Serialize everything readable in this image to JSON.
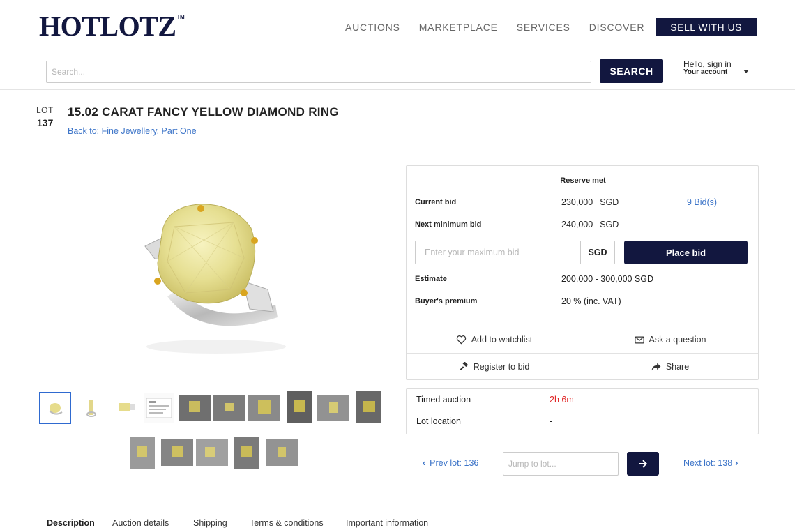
{
  "brand": {
    "logo_text": "HOTLOTZ",
    "logo_mark": "TM"
  },
  "nav": {
    "items": [
      {
        "label": "AUCTIONS"
      },
      {
        "label": "MARKETPLACE"
      },
      {
        "label": "SERVICES"
      },
      {
        "label": "DISCOVER"
      }
    ],
    "sell_label": "SELL WITH US"
  },
  "search": {
    "placeholder": "Search...",
    "button_label": "SEARCH"
  },
  "account": {
    "greeting": "Hello, sign in",
    "label": "Your account"
  },
  "lot": {
    "lot_label": "LOT",
    "number": "137",
    "title": "15.02 CARAT FANCY YELLOW DIAMOND RING",
    "back_link": "Back to: Fine Jewellery, Part One"
  },
  "bidding": {
    "reserve_status": "Reserve met",
    "current_bid_label": "Current bid",
    "current_bid_value": "230,000",
    "currency": "SGD",
    "bids_count_label": "9 Bid(s)",
    "next_min_label": "Next minimum bid",
    "next_min_value": "240,000",
    "max_bid_placeholder": "Enter your maximum bid",
    "currency_addon": "SGD",
    "place_bid_label": "Place bid",
    "estimate_label": "Estimate",
    "estimate_value": "200,000 - 300,000 SGD",
    "premium_label": "Buyer's premium",
    "premium_value": "20 % (inc. VAT)"
  },
  "actions": {
    "watchlist": "Add to watchlist",
    "ask": "Ask a question",
    "register": "Register to bid",
    "share": "Share"
  },
  "auction_info": {
    "type_label": "Timed auction",
    "countdown": "2h 6m",
    "location_label": "Lot location",
    "location_value": "-"
  },
  "pager": {
    "prev_label": "Prev lot: 136",
    "jump_placeholder": "Jump to lot...",
    "next_label": "Next lot: 138"
  },
  "tabs": [
    {
      "label": "Description"
    },
    {
      "label": "Auction details"
    },
    {
      "label": "Shipping"
    },
    {
      "label": "Terms & conditions"
    },
    {
      "label": "Important information"
    }
  ],
  "colors": {
    "brand_navy": "#12173f",
    "link_blue": "#3c74c8",
    "countdown_red": "#e02424"
  }
}
